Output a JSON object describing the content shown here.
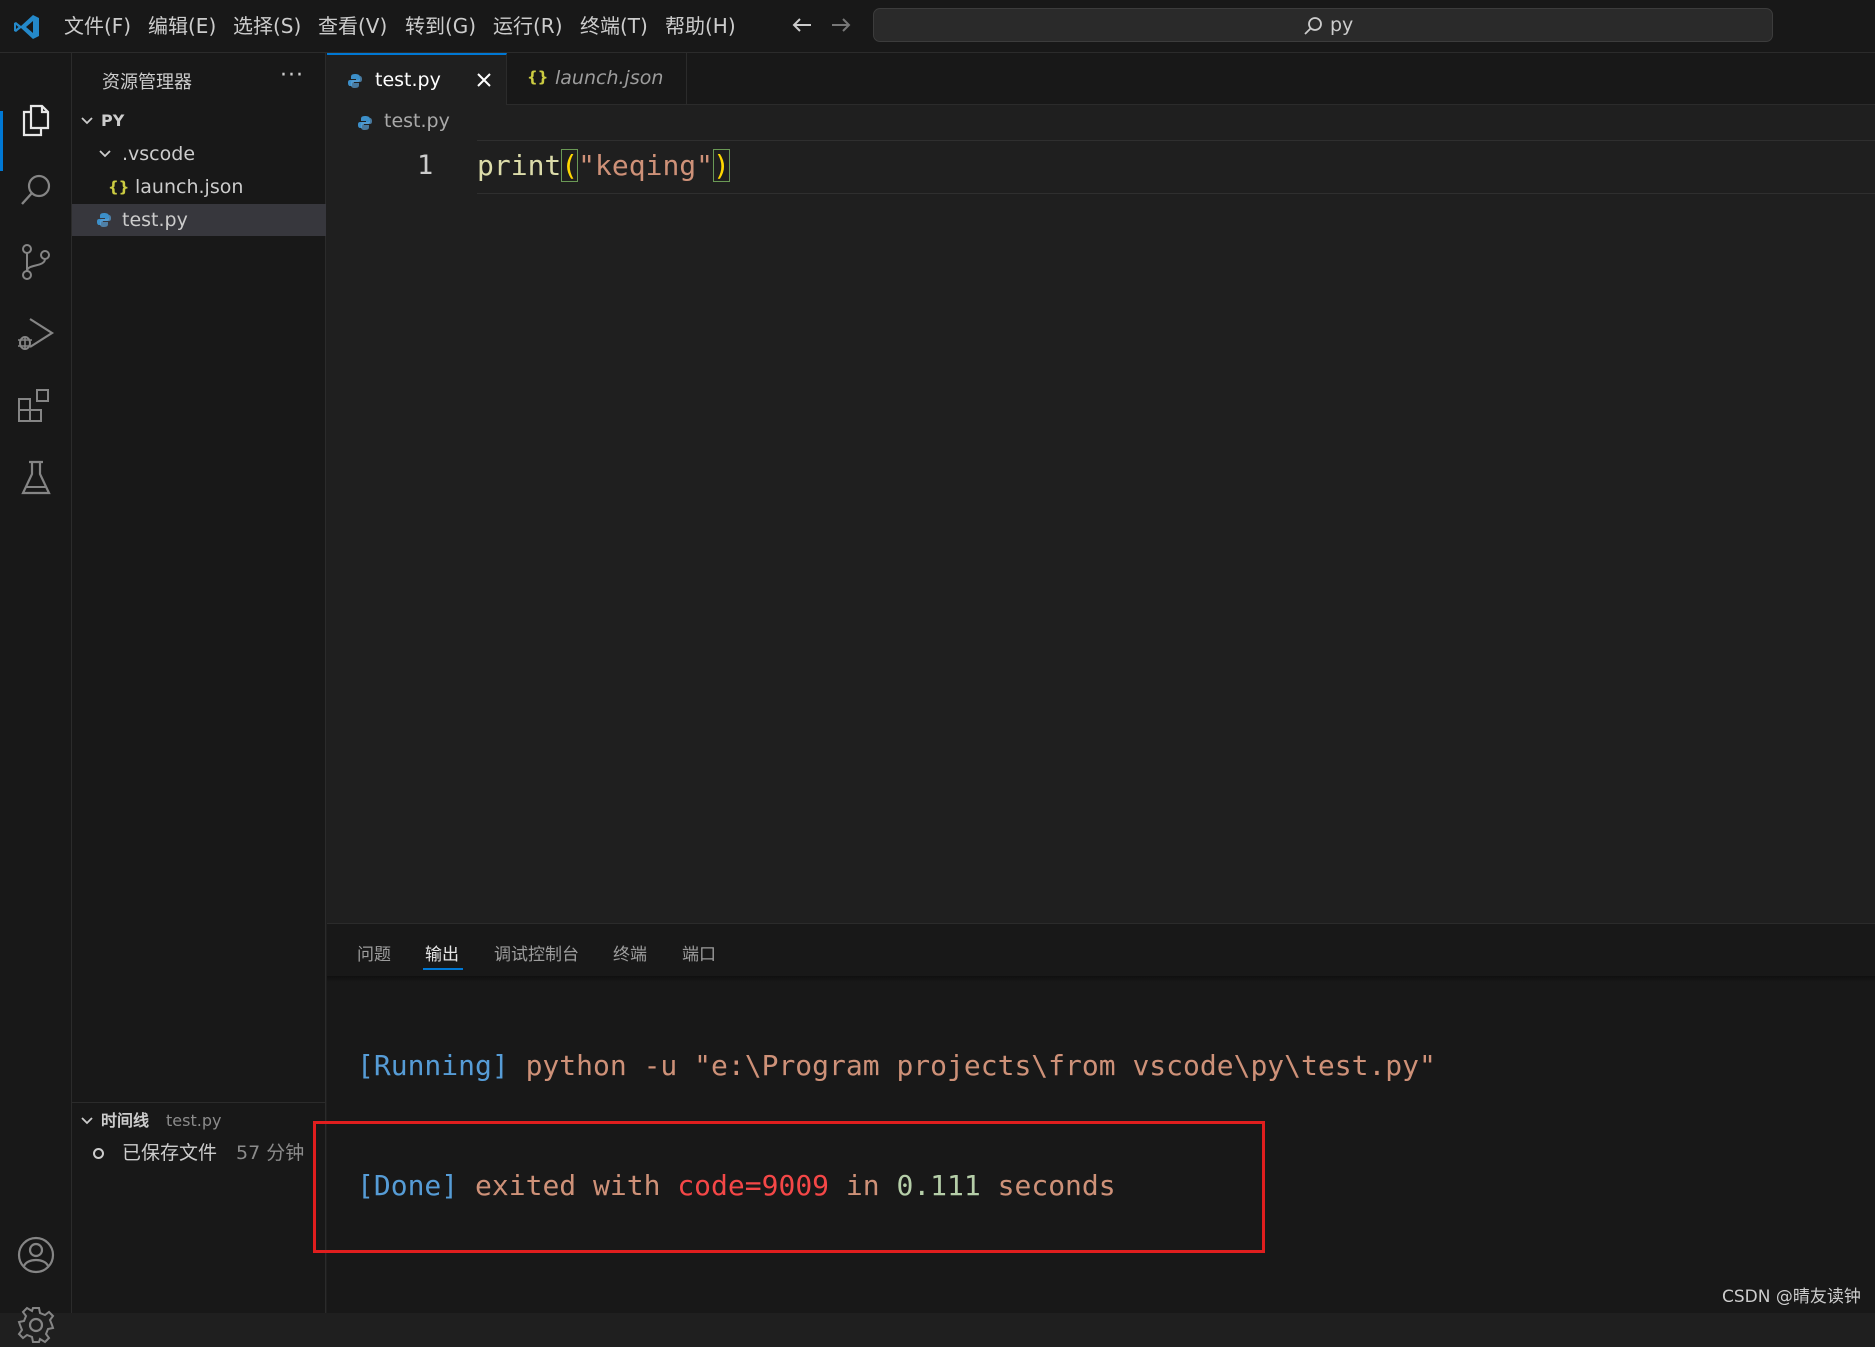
{
  "menu": [
    "文件(F)",
    "编辑(E)",
    "选择(S)",
    "查看(V)",
    "转到(G)",
    "运行(R)",
    "终端(T)",
    "帮助(H)"
  ],
  "search": {
    "text": "py"
  },
  "colors": {
    "accent": "#0078d4",
    "background": "#1f1f1f",
    "highlight_box": "#e01e1e"
  },
  "icons": {
    "activity": [
      "explorer-icon",
      "search-icon",
      "source-control-icon",
      "run-debug-icon",
      "extensions-icon",
      "testing-icon",
      "account-icon",
      "settings-icon"
    ]
  },
  "sidebar": {
    "title": "资源管理器",
    "more": "···",
    "root": "PY",
    "folder": ".vscode",
    "files": {
      "launch": "launch.json",
      "test": "test.py"
    },
    "timeline": {
      "title": "时间线",
      "file": "test.py",
      "entry": "已保存文件",
      "time": "57 分钟"
    }
  },
  "tabs": {
    "active": "test.py",
    "inactive": "launch.json"
  },
  "breadcrumb": "test.py",
  "editor": {
    "line_number": "1",
    "code": {
      "fn": "print",
      "open": "(",
      "str": "\"keqing\"",
      "close": ")"
    }
  },
  "panel": {
    "tabs": [
      "问题",
      "输出",
      "调试控制台",
      "终端",
      "端口"
    ],
    "running": {
      "tag": "[Running]",
      "cmd": " python -u \"e:\\Program projects\\from vscode\\py\\test.py\""
    },
    "done": {
      "tag": "[Done]",
      "a": " exited with ",
      "code": "code=9009",
      "b": " in ",
      "secs": "0.111",
      "c": " seconds"
    }
  },
  "watermark": "CSDN @晴友读钟"
}
